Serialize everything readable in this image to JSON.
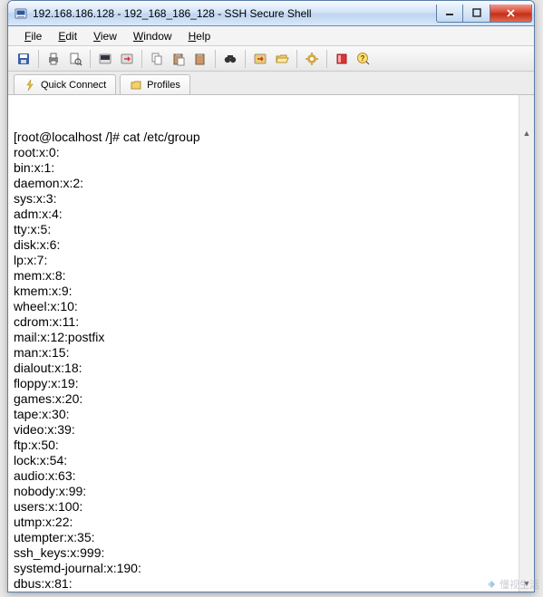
{
  "window": {
    "title": "192.168.186.128 - 192_168_186_128 - SSH Secure Shell"
  },
  "menubar": {
    "items": [
      {
        "label": "File",
        "ul": "F"
      },
      {
        "label": "Edit",
        "ul": "E"
      },
      {
        "label": "View",
        "ul": "V"
      },
      {
        "label": "Window",
        "ul": "W"
      },
      {
        "label": "Help",
        "ul": "H"
      }
    ]
  },
  "tabs": {
    "quick_connect": "Quick Connect",
    "profiles": "Profiles"
  },
  "terminal": {
    "prompt": "[root@localhost /]# ",
    "command": "cat /etc/group",
    "output": [
      "root:x:0:",
      "bin:x:1:",
      "daemon:x:2:",
      "sys:x:3:",
      "adm:x:4:",
      "tty:x:5:",
      "disk:x:6:",
      "lp:x:7:",
      "mem:x:8:",
      "kmem:x:9:",
      "wheel:x:10:",
      "cdrom:x:11:",
      "mail:x:12:postfix",
      "man:x:15:",
      "dialout:x:18:",
      "floppy:x:19:",
      "games:x:20:",
      "tape:x:30:",
      "video:x:39:",
      "ftp:x:50:",
      "lock:x:54:",
      "audio:x:63:",
      "nobody:x:99:",
      "users:x:100:",
      "utmp:x:22:",
      "utempter:x:35:",
      "ssh_keys:x:999:",
      "systemd-journal:x:190:",
      "dbus:x:81:"
    ]
  },
  "watermark": {
    "text": "懂视生活"
  }
}
